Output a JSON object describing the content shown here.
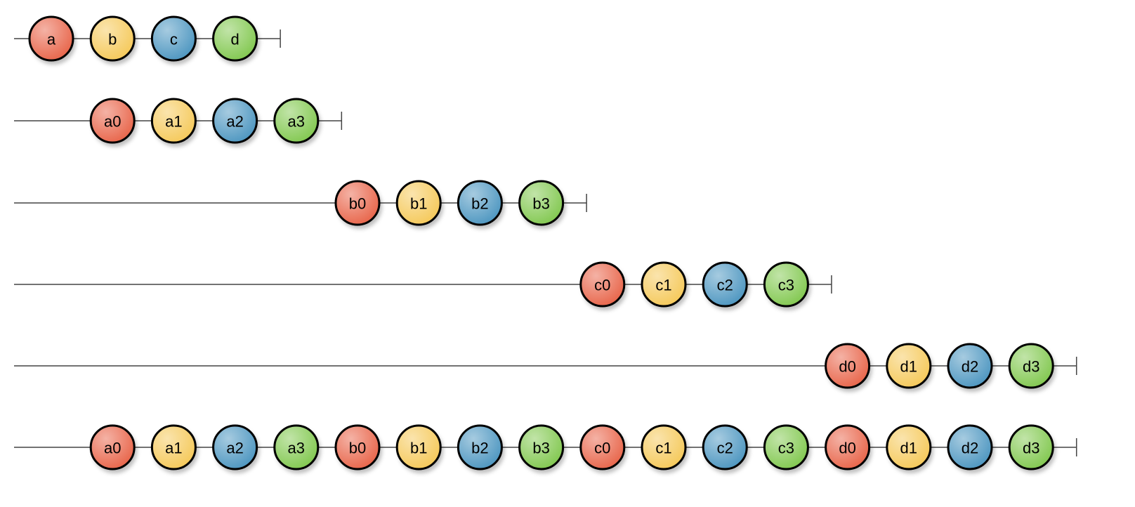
{
  "colors": {
    "red": "#e8654a",
    "yellow": "#f5c95a",
    "blue": "#4d96c0",
    "green": "#82c850",
    "line": "#444444",
    "stroke": "#000000"
  },
  "timelines": [
    {
      "marbles": [
        {
          "label": "a",
          "color": "red",
          "t": 0
        },
        {
          "label": "b",
          "color": "yellow",
          "t": 1
        },
        {
          "label": "c",
          "color": "blue",
          "t": 2
        },
        {
          "label": "d",
          "color": "green",
          "t": 3
        }
      ],
      "complete": 3.74
    },
    {
      "marbles": [
        {
          "label": "a0",
          "color": "red",
          "t": 1
        },
        {
          "label": "a1",
          "color": "yellow",
          "t": 2
        },
        {
          "label": "a2",
          "color": "blue",
          "t": 3
        },
        {
          "label": "a3",
          "color": "green",
          "t": 4
        }
      ],
      "complete": 4.74
    },
    {
      "marbles": [
        {
          "label": "b0",
          "color": "red",
          "t": 5
        },
        {
          "label": "b1",
          "color": "yellow",
          "t": 6
        },
        {
          "label": "b2",
          "color": "blue",
          "t": 7
        },
        {
          "label": "b3",
          "color": "green",
          "t": 8
        }
      ],
      "complete": 8.74
    },
    {
      "marbles": [
        {
          "label": "c0",
          "color": "red",
          "t": 9
        },
        {
          "label": "c1",
          "color": "yellow",
          "t": 10
        },
        {
          "label": "c2",
          "color": "blue",
          "t": 11
        },
        {
          "label": "c3",
          "color": "green",
          "t": 12
        }
      ],
      "complete": 12.74
    },
    {
      "marbles": [
        {
          "label": "d0",
          "color": "red",
          "t": 13
        },
        {
          "label": "d1",
          "color": "yellow",
          "t": 14
        },
        {
          "label": "d2",
          "color": "blue",
          "t": 15
        },
        {
          "label": "d3",
          "color": "green",
          "t": 16
        }
      ],
      "complete": 16.74
    },
    {
      "marbles": [
        {
          "label": "a0",
          "color": "red",
          "t": 1
        },
        {
          "label": "a1",
          "color": "yellow",
          "t": 2
        },
        {
          "label": "a2",
          "color": "blue",
          "t": 3
        },
        {
          "label": "a3",
          "color": "green",
          "t": 4
        },
        {
          "label": "b0",
          "color": "red",
          "t": 5
        },
        {
          "label": "b1",
          "color": "yellow",
          "t": 6
        },
        {
          "label": "b2",
          "color": "blue",
          "t": 7
        },
        {
          "label": "b3",
          "color": "green",
          "t": 8
        },
        {
          "label": "c0",
          "color": "red",
          "t": 9
        },
        {
          "label": "c1",
          "color": "yellow",
          "t": 10
        },
        {
          "label": "c2",
          "color": "blue",
          "t": 11
        },
        {
          "label": "c3",
          "color": "green",
          "t": 12
        },
        {
          "label": "d0",
          "color": "red",
          "t": 13
        },
        {
          "label": "d1",
          "color": "yellow",
          "t": 14
        },
        {
          "label": "d2",
          "color": "blue",
          "t": 15
        },
        {
          "label": "d3",
          "color": "green",
          "t": 16
        }
      ],
      "complete": 16.74
    }
  ]
}
